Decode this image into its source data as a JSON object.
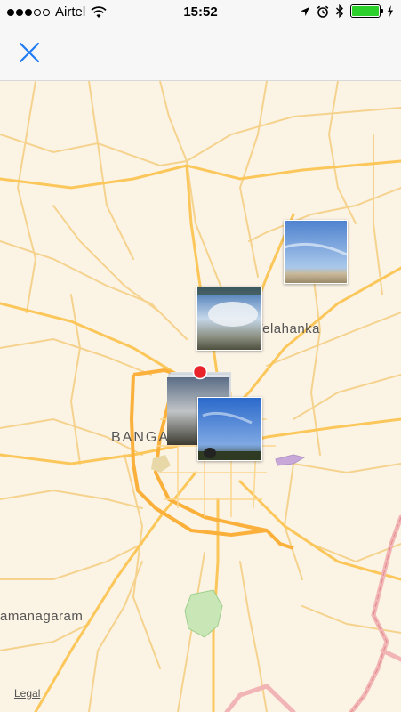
{
  "status": {
    "carrier": "Airtel",
    "time": "15:52",
    "signal_bars_filled": 3,
    "signal_bars_total": 5,
    "battery_level": 1.0,
    "icons": [
      "wifi-icon",
      "location-arrow-icon",
      "alarm-icon",
      "bluetooth-icon",
      "battery-icon",
      "charging-icon"
    ]
  },
  "nav": {
    "close_icon": "close-icon",
    "accent_color": "#1e7cf5"
  },
  "map": {
    "labels": {
      "city": "BANGA",
      "yelahanka": "Yelahanka",
      "ramanagaram": "amanagaram"
    },
    "legal": "Legal"
  },
  "photos": [
    {
      "name": "sky-over-water",
      "description": "clear blue sky"
    },
    {
      "name": "clouds-over-city",
      "description": "cloudy sky"
    },
    {
      "name": "hazy-skyline-stack",
      "description": "hazy city"
    },
    {
      "name": "blue-sky-trees",
      "description": "blue sky"
    }
  ]
}
